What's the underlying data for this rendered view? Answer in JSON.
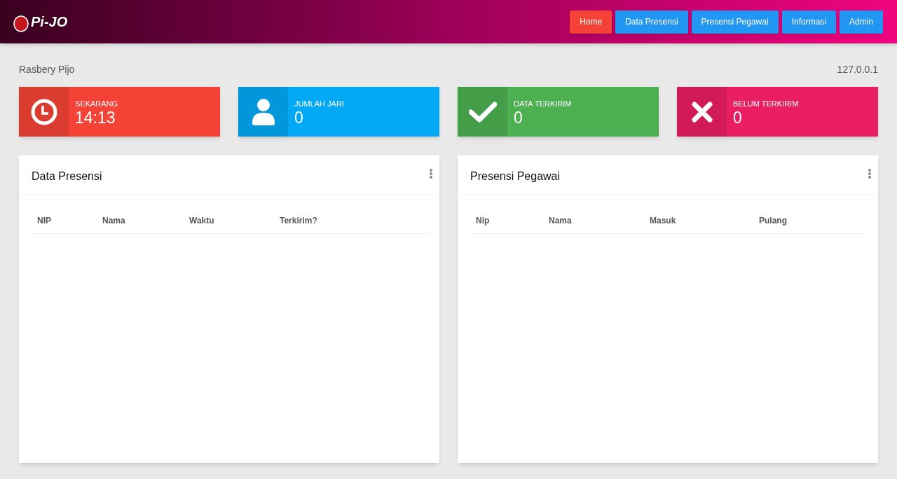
{
  "header": {
    "logo_text": "Pi-JO",
    "nav": [
      {
        "label": "Home",
        "selected": true
      },
      {
        "label": "Data Presensi",
        "selected": false
      },
      {
        "label": "Presensi Pegawai",
        "selected": false
      },
      {
        "label": "Informasi",
        "selected": false
      },
      {
        "label": "Admin",
        "selected": false
      }
    ]
  },
  "breadcrumb": "Rasbery Pijo",
  "ip": "127.0.0.1",
  "stats": [
    {
      "kind": "clock",
      "label": "SEKARANG",
      "value": "14:13",
      "color": "#f44336"
    },
    {
      "kind": "person",
      "label": "JUMLAH JARI",
      "value": "0",
      "color": "#03a9f4"
    },
    {
      "kind": "check",
      "label": "DATA TERKIRIM",
      "value": "0",
      "color": "#4caf50"
    },
    {
      "kind": "cross",
      "label": "BELUM TERKIRIM",
      "value": "0",
      "color": "#e91e63"
    }
  ],
  "panels": [
    {
      "title": "Data Presensi",
      "columns": [
        "NIP",
        "Nama",
        "Waktu",
        "Terkirim?"
      ]
    },
    {
      "title": "Presensi Pegawai",
      "columns": [
        "Nip",
        "Nama",
        "Masuk",
        "Pulang"
      ]
    }
  ]
}
